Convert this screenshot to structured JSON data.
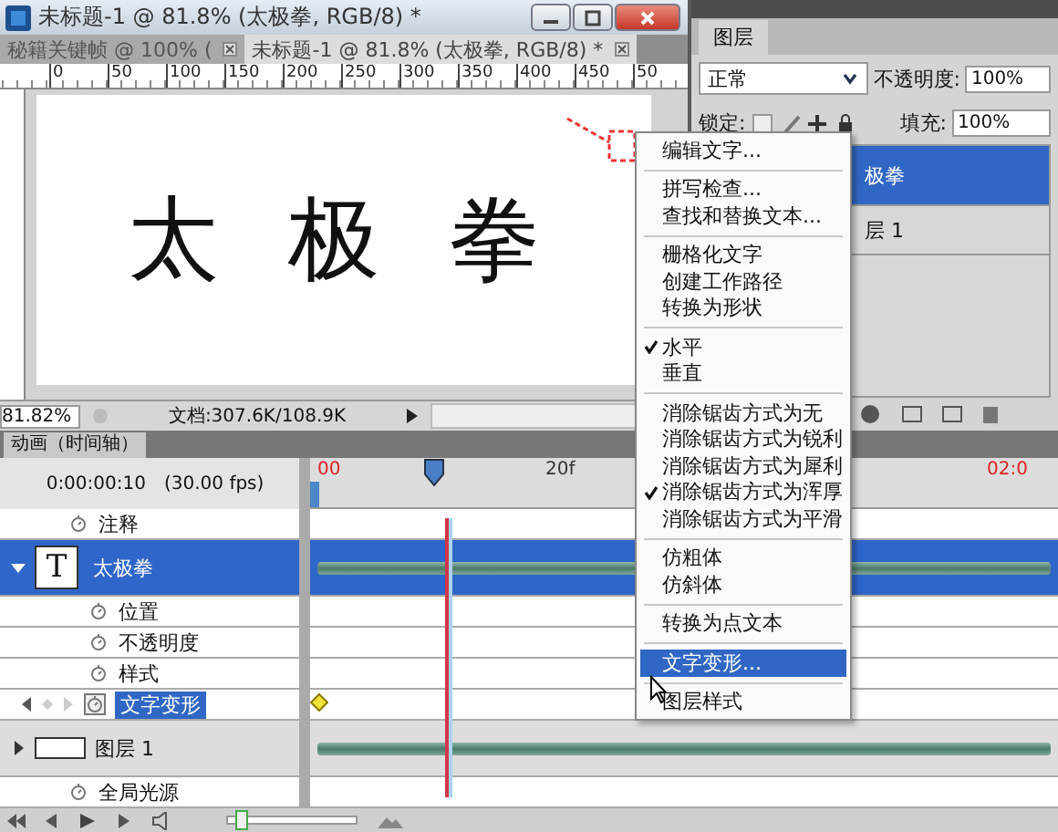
{
  "document": {
    "title": "未标题-1 @ 81.8% (太极拳, RGB/8) *",
    "tabs": [
      {
        "label": "秘籍关键帧 @ 100% (",
        "selected": false
      },
      {
        "label": "未标题-1 @ 81.8% (太极拳, RGB/8) *",
        "selected": true
      }
    ],
    "ruler": [
      "0",
      "50",
      "100",
      "150",
      "200",
      "250",
      "300",
      "350",
      "400",
      "450",
      "50"
    ],
    "canvas_text": "太极拳",
    "zoom": "81.82%",
    "doc_info": "文档:307.6K/108.9K"
  },
  "layers_panel": {
    "tab": "图层",
    "blend_mode": "正常",
    "opacity_label": "不透明度:",
    "opacity": "100%",
    "lock_label": "锁定:",
    "fill_label": "填充:",
    "fill": "100%",
    "layers": [
      {
        "name": "极拳",
        "selected": true
      },
      {
        "name": "层 1",
        "selected": false
      }
    ]
  },
  "timeline": {
    "tab": "动画（时间轴）",
    "time": "0:00:00:10",
    "fps": "(30.00 fps)",
    "zoom_slider": {
      "level": 0.05
    },
    "ruler": [
      {
        "label": "00",
        "kind": "second"
      },
      {
        "label": "20f",
        "kind": "frame"
      },
      {
        "label": "02:0",
        "kind": "second"
      }
    ],
    "rows": [
      {
        "kind": "property",
        "label": "注释",
        "selected": false
      },
      {
        "kind": "layer",
        "label": "太极拳",
        "thumb": "T",
        "expanded": true,
        "selected": true,
        "children": [
          {
            "kind": "property",
            "label": "位置",
            "selected": false
          },
          {
            "kind": "property",
            "label": "不透明度",
            "selected": false
          },
          {
            "kind": "property",
            "label": "样式",
            "selected": false
          },
          {
            "kind": "property",
            "label": "文字变形",
            "selected": true,
            "keyframe": true
          }
        ]
      },
      {
        "kind": "layer",
        "label": "图层 1",
        "expanded": false,
        "selected": false
      },
      {
        "kind": "property",
        "label": "全局光源",
        "selected": false
      }
    ]
  },
  "context_menu": {
    "items": [
      {
        "kind": "item",
        "label": "编辑文字...",
        "checked": false,
        "selected": false
      },
      {
        "kind": "separator"
      },
      {
        "kind": "item",
        "label": "拼写检查...",
        "checked": false,
        "selected": false
      },
      {
        "kind": "item",
        "label": "查找和替换文本...",
        "checked": false,
        "selected": false
      },
      {
        "kind": "separator"
      },
      {
        "kind": "item",
        "label": "栅格化文字",
        "checked": false,
        "selected": false
      },
      {
        "kind": "item",
        "label": "创建工作路径",
        "checked": false,
        "selected": false
      },
      {
        "kind": "item",
        "label": "转换为形状",
        "checked": false,
        "selected": false
      },
      {
        "kind": "separator"
      },
      {
        "kind": "item",
        "label": "水平",
        "checked": true,
        "selected": false
      },
      {
        "kind": "item",
        "label": "垂直",
        "checked": false,
        "selected": false
      },
      {
        "kind": "separator"
      },
      {
        "kind": "item",
        "label": "消除锯齿方式为无",
        "checked": false,
        "selected": false
      },
      {
        "kind": "item",
        "label": "消除锯齿方式为锐利",
        "checked": false,
        "selected": false
      },
      {
        "kind": "item",
        "label": "消除锯齿方式为犀利",
        "checked": false,
        "selected": false
      },
      {
        "kind": "item",
        "label": "消除锯齿方式为浑厚",
        "checked": true,
        "selected": false
      },
      {
        "kind": "item",
        "label": "消除锯齿方式为平滑",
        "checked": false,
        "selected": false
      },
      {
        "kind": "separator"
      },
      {
        "kind": "item",
        "label": "仿粗体",
        "checked": false,
        "selected": false
      },
      {
        "kind": "item",
        "label": "仿斜体",
        "checked": false,
        "selected": false
      },
      {
        "kind": "separator"
      },
      {
        "kind": "item",
        "label": "转换为点文本",
        "checked": false,
        "selected": false
      },
      {
        "kind": "separator"
      },
      {
        "kind": "item",
        "label": "文字变形...",
        "checked": false,
        "selected": true
      },
      {
        "kind": "separator"
      },
      {
        "kind": "item",
        "label": "图层样式",
        "checked": false,
        "selected": false
      }
    ]
  }
}
